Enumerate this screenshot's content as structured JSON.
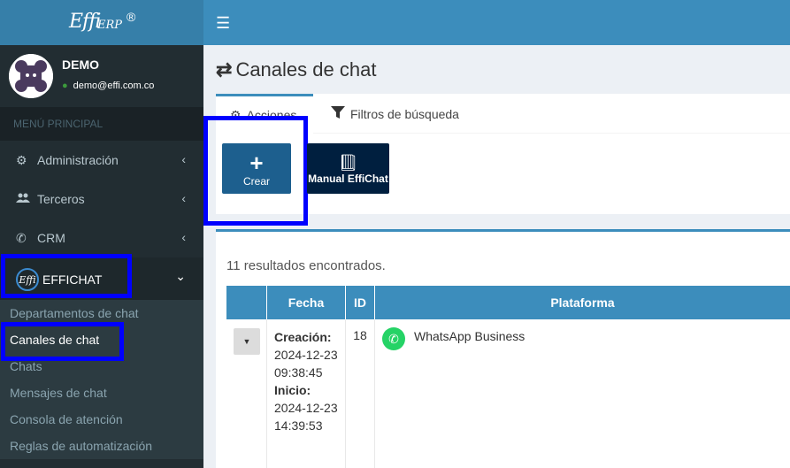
{
  "brand": {
    "logo_main": "Effi",
    "logo_sub": "ERP",
    "logo_reg": "®"
  },
  "user": {
    "name": "DEMO",
    "email": "demo@effi.com.co"
  },
  "sidebar": {
    "header": "MENÚ PRINCIPAL",
    "items": [
      {
        "label": "Administración",
        "icon": "gears-icon"
      },
      {
        "label": "Terceros",
        "icon": "users-icon"
      },
      {
        "label": "CRM",
        "icon": "phone-icon"
      },
      {
        "label": "EFFICHAT",
        "icon": "effichat-logo",
        "logo_text": "Effi"
      }
    ],
    "submenu": [
      "Departamentos de chat",
      "Canales de chat",
      "Chats",
      "Mensajes de chat",
      "Consola de atención",
      "Reglas de automatización"
    ]
  },
  "page": {
    "title": "Canales de chat"
  },
  "tabs": [
    {
      "label": "Acciones",
      "icon": "gear-icon"
    },
    {
      "label": "Filtros de búsqueda",
      "icon": "filter-icon"
    }
  ],
  "actions": {
    "crear_label": "Crear",
    "manual_label": "Manual EffiChat"
  },
  "results": {
    "count_text": "11 resultados encontrados.",
    "columns": [
      "",
      "Fecha",
      "ID",
      "Plataforma"
    ],
    "rows": [
      {
        "creacion_label": "Creación:",
        "creacion_date": "2024-12-23",
        "creacion_time": "09:38:45",
        "inicio_label": "Inicio:",
        "inicio_date": "2024-12-23",
        "inicio_time": "14:39:53",
        "id": "18",
        "plataforma": "WhatsApp Business"
      }
    ]
  },
  "colors": {
    "header_blue": "#3c8dbc",
    "sidebar_dark": "#222d32",
    "highlight": "#0000ff",
    "crear_btn": "#1d5f8e",
    "manual_btn": "#001f3f",
    "whatsapp": "#25d366"
  }
}
